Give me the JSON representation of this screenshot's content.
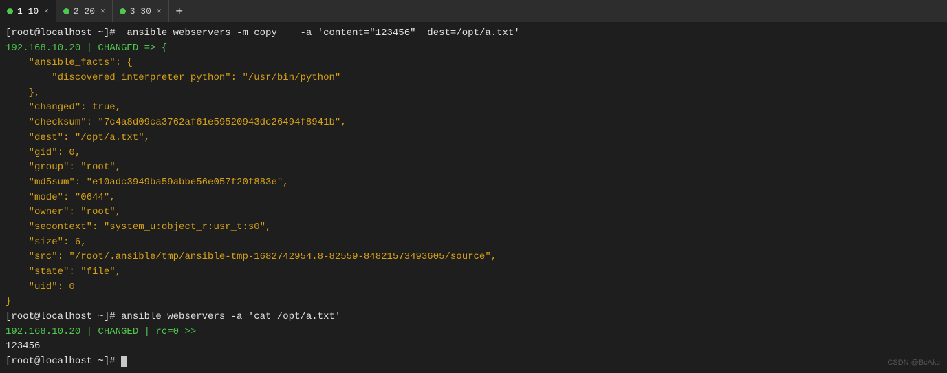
{
  "tabs": [
    {
      "id": 1,
      "dot_color": "#4ec94e",
      "label": "1 10",
      "active": true
    },
    {
      "id": 2,
      "dot_color": "#4ec94e",
      "label": "2 20",
      "active": false
    },
    {
      "id": 3,
      "dot_color": "#4ec94e",
      "label": "3 30",
      "active": false
    }
  ],
  "terminal": {
    "lines": [
      {
        "id": 1,
        "parts": [
          {
            "text": "[root@localhost ~]#  ansible webservers -m copy    -a 'content=\"123456\"  dest=/opt/a.txt'",
            "color": "white"
          }
        ]
      },
      {
        "id": 2,
        "parts": [
          {
            "text": "192.168.10.20 | ",
            "color": "green"
          },
          {
            "text": "CHANGED",
            "color": "green"
          },
          {
            "text": " => {",
            "color": "green"
          }
        ]
      },
      {
        "id": 3,
        "parts": [
          {
            "text": "    \"ansible_facts\": {",
            "color": "gold"
          }
        ]
      },
      {
        "id": 4,
        "parts": [
          {
            "text": "        \"discovered_interpreter_python\": \"/usr/bin/python\"",
            "color": "gold"
          }
        ]
      },
      {
        "id": 5,
        "parts": [
          {
            "text": "    },",
            "color": "gold"
          }
        ]
      },
      {
        "id": 6,
        "parts": [
          {
            "text": "    \"changed\": true,",
            "color": "gold"
          }
        ]
      },
      {
        "id": 7,
        "parts": [
          {
            "text": "    \"checksum\": \"7c4a8d09ca3762af61e59520943dc26494f8941b\",",
            "color": "gold"
          }
        ]
      },
      {
        "id": 8,
        "parts": [
          {
            "text": "    \"dest\": \"/opt/a.txt\",",
            "color": "gold"
          }
        ]
      },
      {
        "id": 9,
        "parts": [
          {
            "text": "    \"gid\": 0,",
            "color": "gold"
          }
        ]
      },
      {
        "id": 10,
        "parts": [
          {
            "text": "    \"group\": \"root\",",
            "color": "gold"
          }
        ]
      },
      {
        "id": 11,
        "parts": [
          {
            "text": "    \"md5sum\": \"e10adc3949ba59abbe56e057f20f883e\",",
            "color": "gold"
          }
        ]
      },
      {
        "id": 12,
        "parts": [
          {
            "text": "    \"mode\": \"0644\",",
            "color": "gold"
          }
        ]
      },
      {
        "id": 13,
        "parts": [
          {
            "text": "    \"owner\": \"root\",",
            "color": "gold"
          }
        ]
      },
      {
        "id": 14,
        "parts": [
          {
            "text": "    \"secontext\": \"system_u:object_r:usr_t:s0\",",
            "color": "gold"
          }
        ]
      },
      {
        "id": 15,
        "parts": [
          {
            "text": "    \"size\": 6,",
            "color": "gold"
          }
        ]
      },
      {
        "id": 16,
        "parts": [
          {
            "text": "    \"src\": \"/root/.ansible/tmp/ansible-tmp-1682742954.8-82559-84821573493605/source\",",
            "color": "gold"
          }
        ]
      },
      {
        "id": 17,
        "parts": [
          {
            "text": "    \"state\": \"file\",",
            "color": "gold"
          }
        ]
      },
      {
        "id": 18,
        "parts": [
          {
            "text": "    \"uid\": 0",
            "color": "gold"
          }
        ]
      },
      {
        "id": 19,
        "parts": [
          {
            "text": "}",
            "color": "gold"
          }
        ]
      },
      {
        "id": 20,
        "parts": [
          {
            "text": "[root@localhost ~]# ansible webservers -a 'cat /opt/a.txt'",
            "color": "white"
          }
        ]
      },
      {
        "id": 21,
        "parts": [
          {
            "text": "192.168.10.20 | CHANGED | rc=0 >>",
            "color": "green"
          }
        ]
      },
      {
        "id": 22,
        "parts": [
          {
            "text": "123456",
            "color": "white"
          }
        ]
      },
      {
        "id": 23,
        "parts": [
          {
            "text": "[root@localhost ~]# ",
            "color": "white"
          }
        ]
      }
    ]
  },
  "watermark": "CSDN @BcAkc"
}
